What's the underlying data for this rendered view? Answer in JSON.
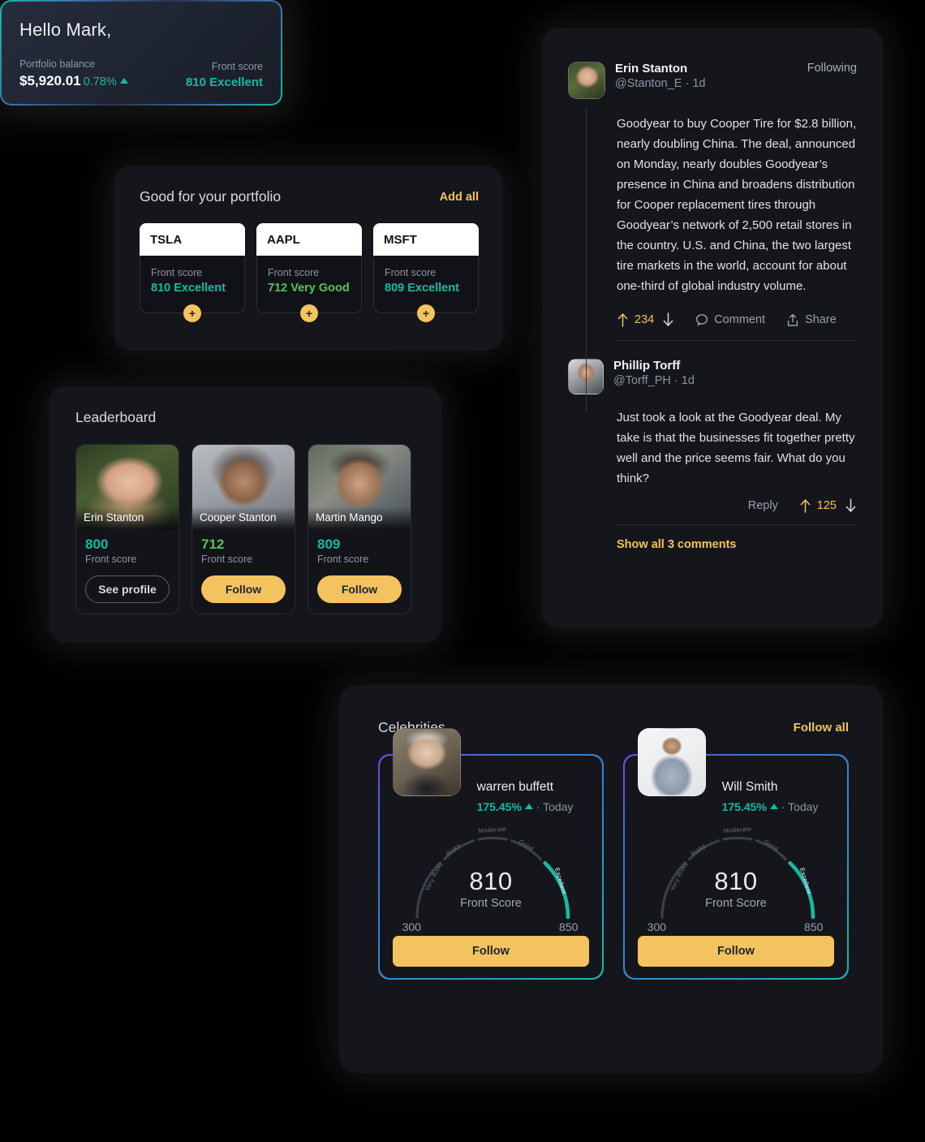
{
  "welcome": {
    "greeting": "Hello Mark,",
    "balance_label": "Portfolio balance",
    "balance_value": "$5,920.01",
    "balance_delta": "0.78%",
    "score_label": "Front score",
    "score_value": "810 Excellent"
  },
  "portfolio": {
    "title": "Good for your portfolio",
    "add_all_label": "Add all",
    "score_label": "Front score",
    "tickers": [
      {
        "symbol": "TSLA",
        "score": "810 Excellent",
        "tone": "teal"
      },
      {
        "symbol": "AAPL",
        "score": "712 Very Good",
        "tone": "green"
      },
      {
        "symbol": "MSFT",
        "score": "809 Excellent",
        "tone": "teal"
      }
    ]
  },
  "leaderboard": {
    "title": "Leaderboard",
    "score_caption": "Front score",
    "people": [
      {
        "name": "Erin Stanton",
        "score": "800",
        "tone": "teal",
        "action": "See profile",
        "style": "outline",
        "photo": "ph-erin"
      },
      {
        "name": "Cooper Stanton",
        "score": "712",
        "tone": "green",
        "action": "Follow",
        "style": "amber",
        "photo": "ph-cooper"
      },
      {
        "name": "Martin Mango",
        "score": "809",
        "tone": "teal",
        "action": "Follow",
        "style": "amber",
        "photo": "ph-martin"
      }
    ]
  },
  "feed": {
    "post": {
      "author": "Erin Stanton",
      "handle": "@Stanton_E · 1d",
      "following_label": "Following",
      "text": "Goodyear to buy Cooper Tire for $2.8 billion, nearly doubling China. The deal, announced on Monday, nearly doubles Goodyear’s presence in China and broadens distribution for Cooper replacement tires through Goodyear’s network of 2,500 retail stores in the country. U.S. and China, the two largest tire markets in the world, account for about one-third of global industry volume.",
      "upvotes": "234",
      "comment_label": "Comment",
      "share_label": "Share"
    },
    "comment": {
      "author": "Phillip Torff",
      "handle": "@Torff_PH · 1d",
      "text": "Just took a look at the Goodyear deal. My take is that the businesses fit together pretty well and the price seems fair. What do you think?",
      "reply_label": "Reply",
      "upvotes": "125"
    },
    "show_all_label": "Show all 3 comments"
  },
  "celebrities": {
    "title": "Celebrities",
    "follow_all_label": "Follow all",
    "cards": [
      {
        "name": "warren buffett",
        "change": "175.45%",
        "period": "· Today",
        "follow_label": "Follow",
        "photo": "ph-warren"
      },
      {
        "name": "Will Smith",
        "change": "175.45%",
        "period": "· Today",
        "follow_label": "Follow",
        "photo": "ph-will"
      }
    ],
    "gauge": {
      "value": "810",
      "caption": "Front Score",
      "min": "300",
      "max": "850",
      "segments": [
        "Very Risky",
        "Risky",
        "Moderate",
        "Good",
        "Excellent"
      ],
      "active_segment": "Excellent"
    }
  },
  "chart_data": [
    {
      "type": "gauge",
      "title": "warren buffett Front Score",
      "value": 810,
      "min": 300,
      "max": 850,
      "bands": [
        {
          "label": "Very Risky",
          "range": [
            300,
            410
          ],
          "active": false
        },
        {
          "label": "Risky",
          "range": [
            410,
            520
          ],
          "active": false
        },
        {
          "label": "Moderate",
          "range": [
            520,
            630
          ],
          "active": false
        },
        {
          "label": "Good",
          "range": [
            630,
            740
          ],
          "active": false
        },
        {
          "label": "Excellent",
          "range": [
            740,
            850
          ],
          "active": true
        }
      ],
      "active_color": "#16b9a4",
      "inactive_color": "#3a3e47"
    },
    {
      "type": "gauge",
      "title": "Will Smith Front Score",
      "value": 810,
      "min": 300,
      "max": 850,
      "bands": [
        {
          "label": "Very Risky",
          "range": [
            300,
            410
          ],
          "active": false
        },
        {
          "label": "Risky",
          "range": [
            410,
            520
          ],
          "active": false
        },
        {
          "label": "Moderate",
          "range": [
            520,
            630
          ],
          "active": false
        },
        {
          "label": "Good",
          "range": [
            630,
            740
          ],
          "active": false
        },
        {
          "label": "Excellent",
          "range": [
            740,
            850
          ],
          "active": true
        }
      ],
      "active_color": "#16b9a4",
      "inactive_color": "#3a3e47"
    }
  ],
  "colors": {
    "amber": "#f3c35f",
    "teal": "#16b9a4",
    "green": "#54c555",
    "card_bg": "#14161c",
    "page_bg": "#000000"
  },
  "icons": {
    "upvote": "upvote-arrow-icon",
    "downvote": "downvote-arrow-icon",
    "comment": "comment-bubble-icon",
    "share": "share-icon",
    "plus": "plus-icon",
    "trend_up": "trend-up-triangle-icon"
  }
}
